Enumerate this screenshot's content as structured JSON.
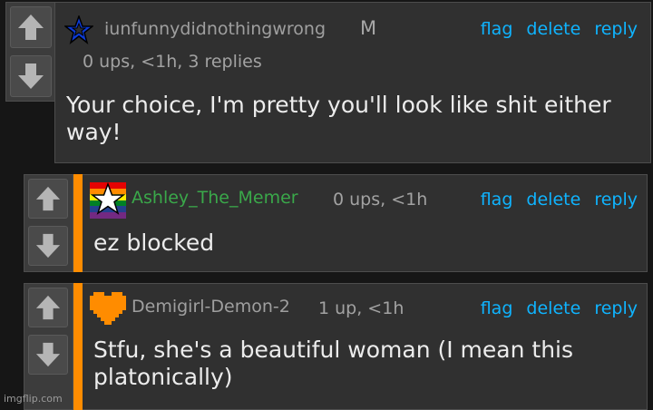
{
  "comments": [
    {
      "username": "iunfunnydidnothingwrong",
      "badge": "M",
      "meta": "0 ups, <1h, 3 replies",
      "body": "Your choice, I'm pretty you'll look like shit either way!",
      "avatar_icon": "blue-star-icon",
      "accent": false
    },
    {
      "username": "Ashley_The_Memer",
      "meta": "0 ups, <1h",
      "body": "ez blocked",
      "avatar_icon": "rainbow-flag-star-icon",
      "username_color": "#3aa84a",
      "accent": true
    },
    {
      "username": "Demigirl-Demon-2",
      "meta": "1 up, <1h",
      "body": "Stfu, she's a beautiful woman (I mean this platonically)",
      "avatar_icon": "orange-pixel-heart-icon",
      "accent": true
    }
  ],
  "actions": {
    "flag": "flag",
    "delete": "delete",
    "reply": "reply"
  },
  "watermark": "imgflip.com",
  "colors": {
    "background": "#161616",
    "panel": "#303030",
    "accent": "#ff8c00",
    "link": "#0fb4ff"
  }
}
